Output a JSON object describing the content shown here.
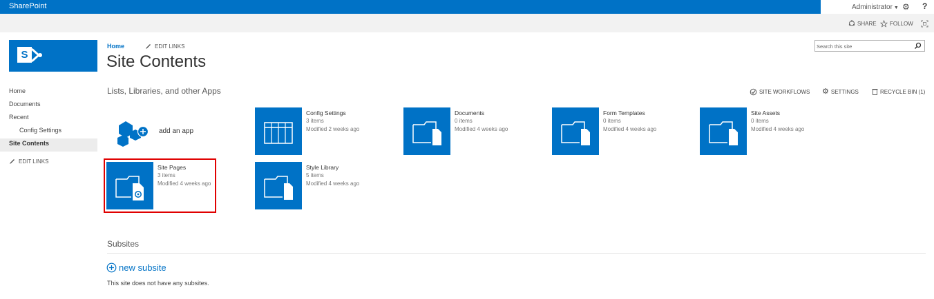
{
  "suite": {
    "brand": "SharePoint",
    "user": "Administrator",
    "help": "?"
  },
  "ribbon": {
    "share": "SHARE",
    "follow": "FOLLOW"
  },
  "topnav": {
    "home": "Home",
    "edit_links": "EDIT LINKS"
  },
  "page": {
    "title": "Site Contents"
  },
  "search": {
    "placeholder": "Search this site"
  },
  "leftnav": {
    "items": [
      "Home",
      "Documents",
      "Recent",
      "Config Settings",
      "Site Contents"
    ],
    "edit_links": "EDIT LINKS"
  },
  "section": {
    "lists_heading": "Lists, Libraries, and other Apps"
  },
  "toolbar": {
    "workflows": "SITE WORKFLOWS",
    "settings": "SETTINGS",
    "recycle": "RECYCLE BIN (1)"
  },
  "add_app": {
    "label": "add an app"
  },
  "tiles": [
    {
      "title": "Config Settings",
      "count": "3 items",
      "modified": "Modified 2 weeks ago",
      "icon": "list-grid-icon"
    },
    {
      "title": "Documents",
      "count": "0 items",
      "modified": "Modified 4 weeks ago",
      "icon": "folder-icon"
    },
    {
      "title": "Form Templates",
      "count": "0 items",
      "modified": "Modified 4 weeks ago",
      "icon": "folder-icon"
    },
    {
      "title": "Site Assets",
      "count": "0 items",
      "modified": "Modified 4 weeks ago",
      "icon": "folder-icon"
    },
    {
      "title": "Site Pages",
      "count": "3 items",
      "modified": "Modified 4 weeks ago",
      "icon": "folder-pages-icon"
    },
    {
      "title": "Style Library",
      "count": "5 items",
      "modified": "Modified 4 weeks ago",
      "icon": "folder-icon"
    }
  ],
  "subsites": {
    "heading": "Subsites",
    "new_label": "new subsite",
    "empty": "This site does not have any subsites."
  },
  "colors": {
    "brand_blue": "#0072c6",
    "highlight_red": "#e00000"
  }
}
